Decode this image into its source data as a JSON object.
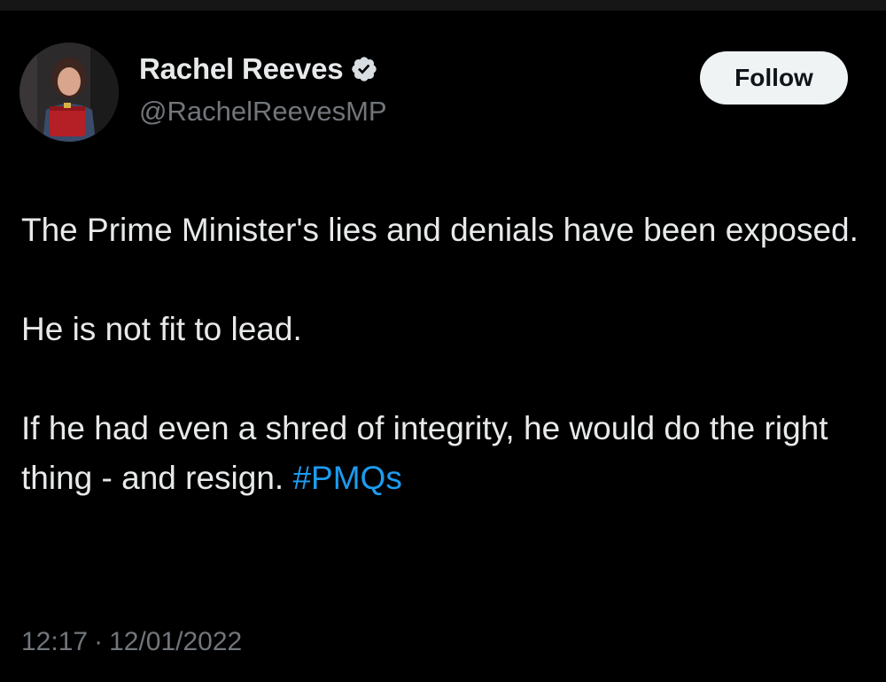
{
  "author": {
    "display_name": "Rachel Reeves",
    "handle": "@RachelReevesMP",
    "verified": true
  },
  "follow_button": {
    "label": "Follow"
  },
  "tweet": {
    "paragraphs": [
      "The Prime Minister's lies and denials have been exposed.",
      "He is not fit to lead."
    ],
    "last_paragraph_text": "If he had even a shred of integrity, he would do the right thing - and resign.",
    "hashtag": "#PMQs"
  },
  "meta": {
    "time": "12:17",
    "separator": "·",
    "date": "12/01/2022"
  },
  "colors": {
    "background": "#000000",
    "text_primary": "#e7e9ea",
    "text_secondary": "#71767b",
    "link": "#1d9bf0",
    "verified_badge": "#1d9bf0",
    "button_bg": "#eff3f4"
  },
  "icons": {
    "verified": "verified-badge-icon"
  }
}
